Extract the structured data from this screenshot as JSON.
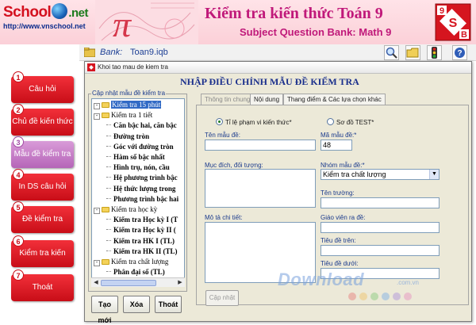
{
  "header": {
    "logo_school": "School",
    "logo_net": ".net",
    "logo_url": "http://www.vnschool.net",
    "title_vi": "Kiểm tra kiến thức Toán 9",
    "title_en": "Subject Question Bank: Math 9",
    "badge_top": "9",
    "badge_mid": "S",
    "badge_bot": "B"
  },
  "sidebar": {
    "items": [
      {
        "num": "1",
        "label": "Câu hỏi"
      },
      {
        "num": "2",
        "label": "Chủ đề kiến thức"
      },
      {
        "num": "3",
        "label": "Mẫu đề kiểm tra",
        "active": true
      },
      {
        "num": "4",
        "label": "In DS câu hỏi"
      },
      {
        "num": "5",
        "label": "Đề kiểm tra"
      },
      {
        "num": "6",
        "label": "Kiểm tra kiến thức"
      },
      {
        "num": "7",
        "label": "Thoát"
      }
    ]
  },
  "bank_bar": {
    "label": "Bank:",
    "file": "Toan9.iqb",
    "tools": [
      "search-icon",
      "folder-open-icon",
      "traffic-light-icon",
      "help-icon"
    ]
  },
  "dialog": {
    "window_title": "Khoi tao mau de kiem tra",
    "heading": "NHẬP ĐIỀU CHỈNH MẪU ĐỀ KIỂM TRA",
    "tree_caption": "Cập nhật mẫu đề kiểm tra",
    "tree": [
      {
        "level": 0,
        "pm": "-",
        "text": "Kiểm tra 15 phút",
        "selected": true
      },
      {
        "level": 0,
        "pm": "-",
        "text": "Kiểm tra 1 tiết"
      },
      {
        "level": 1,
        "text": "Căn bậc hai, căn bậc"
      },
      {
        "level": 1,
        "text": "Đường tròn"
      },
      {
        "level": 1,
        "text": "Góc với đường tròn"
      },
      {
        "level": 1,
        "text": "Hàm số bậc nhất"
      },
      {
        "level": 1,
        "text": "Hình trụ, nón, cầu"
      },
      {
        "level": 1,
        "text": "Hệ phương trình bậc"
      },
      {
        "level": 1,
        "text": "Hệ thức lượng trong"
      },
      {
        "level": 1,
        "text": "Phương trình bậc hai"
      },
      {
        "level": 0,
        "pm": "-",
        "text": "Kiểm tra học kỳ"
      },
      {
        "level": 1,
        "text": "Kiểm tra Học kỳ I (T"
      },
      {
        "level": 1,
        "text": "Kiểm tra Học kỳ II ("
      },
      {
        "level": 1,
        "text": "Kiểm tra HK I (TL)"
      },
      {
        "level": 1,
        "text": "Kiểm tra HK II (TL)"
      },
      {
        "level": 0,
        "pm": "-",
        "text": "Kiểm tra chất lượng"
      },
      {
        "level": 1,
        "text": "Phân đại số (TL)"
      }
    ],
    "buttons": {
      "new": "Tạo mới",
      "delete": "Xóa",
      "exit": "Thoát"
    },
    "tabs": [
      "Thông tin chung",
      "Nội dung",
      "Thang điểm & Các lựa chọn khác"
    ],
    "form": {
      "radio_ratio": "Tỉ lệ phạm vi kiến thức*",
      "radio_diagram": "Sơ đồ TEST*",
      "name_label": "Tên mẫu đề:",
      "name_value": "",
      "code_label": "Mã mẫu đề:*",
      "code_value": "48",
      "purpose_label": "Mục đích, đối tượng:",
      "group_label": "Nhóm mẫu đề:*",
      "group_value": "Kiểm tra chất lượng",
      "school_label": "Tên trường:",
      "desc_label": "Mô tả chi tiết:",
      "teacher_label": "Giáo viên ra đề:",
      "header_label": "Tiêu đề trên:",
      "footer_label": "Tiêu đề dưới:",
      "update_button": "Cập nhật"
    }
  },
  "watermark": {
    "text": "Download",
    "domain": ".com.vn"
  },
  "colors": {
    "sidebar_button": "#e0202a",
    "sidebar_active": "#c47ec6",
    "heading": "#1a2f8c",
    "header_title": "#c0197a"
  }
}
